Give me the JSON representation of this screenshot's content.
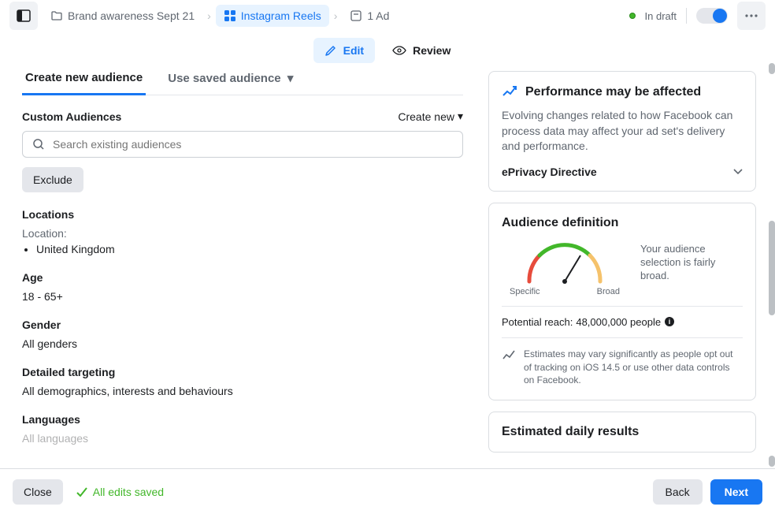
{
  "breadcrumb": {
    "campaign": "Brand awareness Sept 21",
    "adset": "Instagram Reels",
    "ad": "1 Ad"
  },
  "status": {
    "label": "In draft"
  },
  "modes": {
    "edit": "Edit",
    "review": "Review"
  },
  "audience_tabs": {
    "create": "Create new audience",
    "saved": "Use saved audience"
  },
  "custom_audiences": {
    "heading": "Custom Audiences",
    "create_new": "Create new",
    "search_placeholder": "Search existing audiences",
    "exclude": "Exclude"
  },
  "locations": {
    "heading": "Locations",
    "sublabel": "Location:",
    "items": [
      "United Kingdom"
    ]
  },
  "age": {
    "heading": "Age",
    "value": "18 - 65+"
  },
  "gender": {
    "heading": "Gender",
    "value": "All genders"
  },
  "targeting": {
    "heading": "Detailed targeting",
    "value": "All demographics, interests and behaviours"
  },
  "languages": {
    "heading": "Languages",
    "value": "All languages"
  },
  "performance_card": {
    "title": "Performance may be affected",
    "body": "Evolving changes related to how Facebook can process data may affect your ad set's delivery and performance.",
    "expander": "ePrivacy Directive"
  },
  "audience_def": {
    "title": "Audience definition",
    "specific": "Specific",
    "broad": "Broad",
    "summary": "Your audience selection is fairly broad.",
    "reach_label": "Potential reach:",
    "reach_value": "48,000,000 people",
    "estimate_note": "Estimates may vary significantly as people opt out of tracking on iOS 14.5 or use other data controls on Facebook."
  },
  "daily_results": {
    "title": "Estimated daily results"
  },
  "footer": {
    "close": "Close",
    "saved": "All edits saved",
    "back": "Back",
    "next": "Next"
  }
}
